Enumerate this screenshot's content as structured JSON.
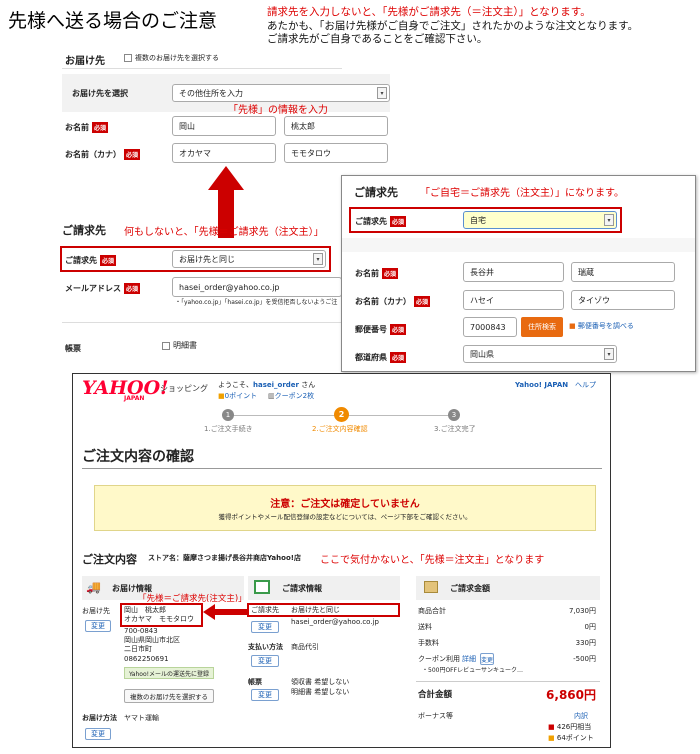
{
  "page": {
    "title": "先様へ送る場合のご注意",
    "note_lines": [
      "請求先を入力しないと、「先様がご請求先（＝注文主）」となります。",
      "あたかも、「お届け先様がご自身でご注文」されたかのような注文となります。",
      "ご請求先がご自身であることをご確認下さい。"
    ]
  },
  "form1": {
    "heading": "お届け先",
    "multi_checkbox_label": "複数のお届け先を選択する",
    "select_label": "お届け先を選択",
    "select_value": "その他住所を入力",
    "note_input": "「先様」の情報を入力",
    "name_label": "お名前",
    "name_last": "岡山",
    "name_first": "桃太郎",
    "kana_label": "お名前（カナ）",
    "kana_last": "オカヤマ",
    "kana_first": "モモタロウ",
    "required": "必須"
  },
  "form2": {
    "heading": "ご請求先",
    "note": "何もしないと、「先様＝ご請求先（注文主）」",
    "select_label": "ご請求先",
    "select_value": "お届け先と同じ",
    "email_label": "メールアドレス",
    "email_value": "hasei_order@yahoo.co.jp",
    "email_note": "・「yahoo.co.jp」「hasei.co.jp」を受信拒否しないようご注",
    "receipt_label": "帳票",
    "receipt_checkbox": "明細書"
  },
  "panel": {
    "heading": "ご請求先",
    "note": "「ご自宅＝ご請求先（注文主）」になります。",
    "select_label": "ご請求先",
    "select_value": "自宅",
    "name_label": "お名前",
    "name_last": "長谷井",
    "name_first": "瑞蔵",
    "kana_label": "お名前（カナ）",
    "kana_last": "ハセイ",
    "kana_first": "タイゾウ",
    "zip_label": "郵便番号",
    "zip_value": "7000843",
    "zip_button": "住所検索",
    "zip_link": "郵便番号を調べる",
    "pref_label": "都道府県",
    "pref_value": "岡山県"
  },
  "yahoo": {
    "logo": "YAHOO!",
    "logo_sub": "JAPAN",
    "shopping": "ショッピング",
    "welcome_pre": "ようこそ、",
    "user": "hasei_order",
    "welcome_post": "さん",
    "points": "0ポイント",
    "coupons": "クーポン2枚",
    "top_link": "Yahoo! JAPAN",
    "help": "ヘルプ",
    "steps": [
      {
        "num": "1",
        "label": "1.ご注文手続き",
        "color": "#888888"
      },
      {
        "num": "2",
        "label": "2.ご注文内容確認",
        "color": "#f08a00"
      },
      {
        "num": "3",
        "label": "3.ご注文完了",
        "color": "#888888"
      }
    ],
    "confirm_title": "ご注文内容の確認",
    "warning_title": "注意：ご注文は確定していません",
    "warning_text": "獲得ポイントやメール配信登録の設定などについては、ページ下部をご確認ください。",
    "content_title": "ご注文内容",
    "store": "ストア名：薩摩さつま揚げ長谷井商店Yahoo!店",
    "content_note": "ここで気付かないと、「先様＝注文主」となります",
    "delivery": {
      "heading": "お届け情報",
      "red_note": "「先様＝ご請求先(注文主)」",
      "to_label": "お届け先",
      "to_name": "岡山　桃太郎",
      "to_kana": "オカヤマ　モモタロウ",
      "zip": "700-0843",
      "addr1": "岡山県岡山市北区",
      "addr2": "二日市町",
      "tel": "0862250691",
      "change": "変更",
      "notice_btn": "Yahoo!メールの運送先に登録",
      "multi_btn": "複数のお届け先を選択する",
      "method_label": "お届け方法",
      "method": "ヤマト運輸"
    },
    "billing": {
      "heading": "ご請求情報",
      "label": "ご請求先",
      "value": "お届け先と同じ",
      "email": "hasei_order@yahoo.co.jp",
      "change": "変更",
      "pay_label": "支払い方法",
      "pay_value": "商品代引",
      "receipt_label": "帳票",
      "receipt1": "領収書 希望しない",
      "receipt2": "明細書 希望しない"
    },
    "amount": {
      "heading": "ご請求金額",
      "rows": [
        {
          "label": "商品合計",
          "value": "7,030円"
        },
        {
          "label": "送料",
          "value": "0円"
        },
        {
          "label": "手数料",
          "value": "330円"
        },
        {
          "label": "クーポン利用",
          "value": "-500円"
        }
      ],
      "coupon_detail": "詳細",
      "coupon_change": "変更",
      "coupon_note": "・500円OFFレビューサンキューク…",
      "total_label": "合計金額",
      "total_value": "6,860円",
      "bonus_label": "ボーナス等",
      "bonus_link": "内訳",
      "bonus1": "426円相当",
      "bonus2": "64ポイント"
    }
  },
  "colors": {
    "accent_red": "#cc0000",
    "yahoo_red": "#ff0033",
    "warning_bg": "#fff9c9",
    "link_blue": "#1a5fb4",
    "select_highlight": "#ffffcc"
  }
}
